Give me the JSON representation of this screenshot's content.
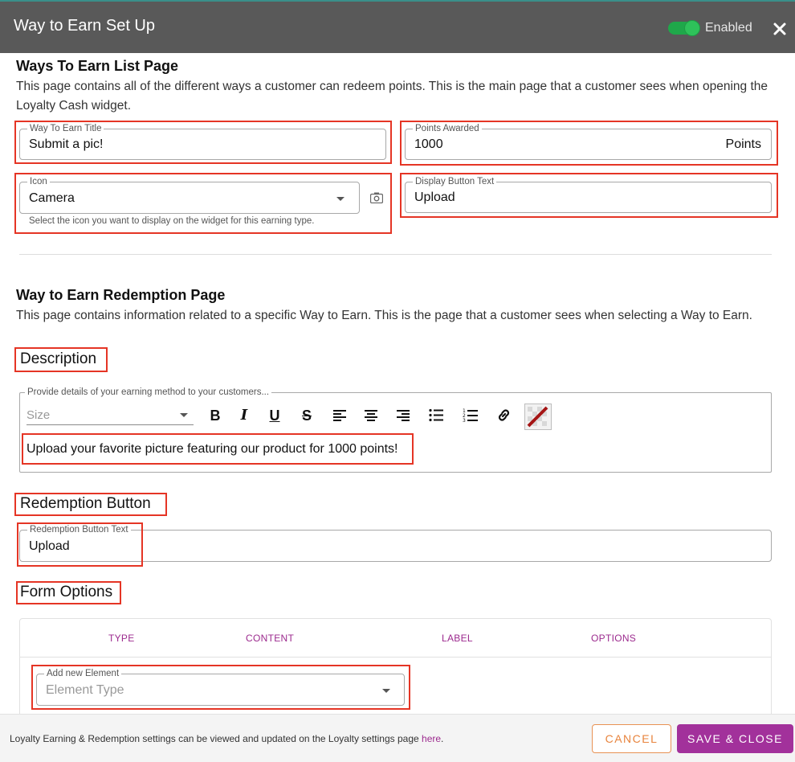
{
  "header": {
    "title": "Way to Earn Set Up",
    "toggle_label": "Enabled"
  },
  "list_page": {
    "title": "Ways To Earn List Page",
    "description": "This page contains all of the different ways a customer can redeem points. This is the main page that a customer sees when opening the Loyalty Cash widget.",
    "way_to_earn_title": {
      "label": "Way To Earn Title",
      "value": "Submit a pic!"
    },
    "points_awarded": {
      "label": "Points Awarded",
      "value": "1000",
      "suffix": "Points"
    },
    "icon": {
      "label": "Icon",
      "value": "Camera",
      "helper": "Select the icon you want to display on the widget for this earning type."
    },
    "display_button_text": {
      "label": "Display Button Text",
      "value": "Upload"
    }
  },
  "redemption_page": {
    "title": "Way to Earn Redemption Page",
    "description": "This page contains information related to a specific Way to Earn. This is the page that a customer sees when selecting a Way to Earn.",
    "description_heading": "Description",
    "editor": {
      "label": "Provide details of your earning method to your customers...",
      "size_placeholder": "Size",
      "content": "Upload your favorite picture featuring our product for 1000 points!"
    },
    "redemption_button_heading": "Redemption Button",
    "redemption_button_text": {
      "label": "Redemption Button Text",
      "value": "Upload"
    },
    "form_options_heading": "Form Options",
    "table_headers": [
      "TYPE",
      "CONTENT",
      "LABEL",
      "OPTIONS"
    ],
    "add_element": {
      "label": "Add new Element",
      "placeholder": "Element Type"
    }
  },
  "footer": {
    "text": "Loyalty Earning & Redemption settings can be viewed and updated on the Loyalty settings page ",
    "link": "here",
    "period": ".",
    "cancel": "CANCEL",
    "save": "SAVE & CLOSE"
  },
  "colors": {
    "header_bg": "#595959",
    "highlight": "#e53525",
    "accent_purple": "#a2319b",
    "accent_orange": "#e8843d",
    "toggle_green": "#1fa84a"
  }
}
